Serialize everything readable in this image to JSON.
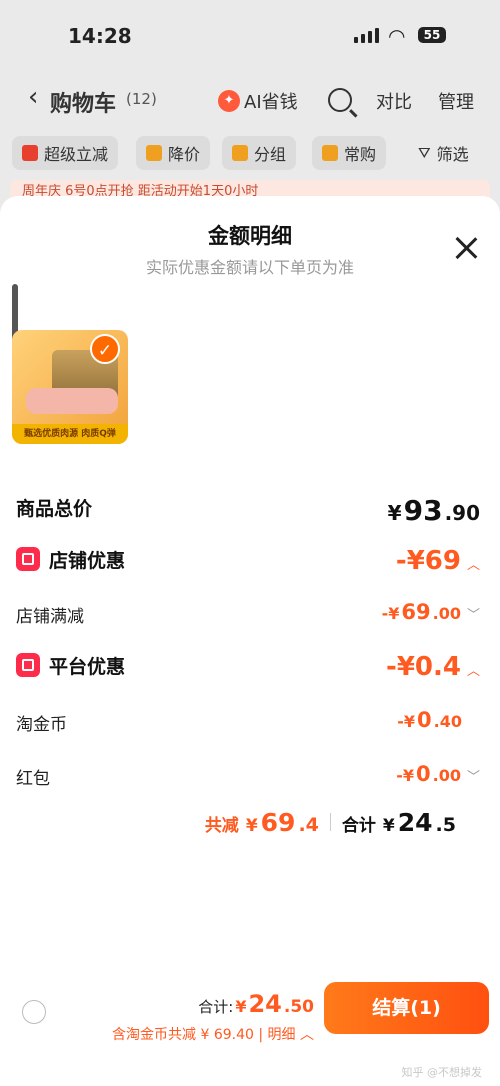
{
  "status": {
    "time": "14:28",
    "battery": "55"
  },
  "nav": {
    "title": "购物车",
    "count": "(12)",
    "ai_label": "AI省钱",
    "compare": "对比",
    "manage": "管理"
  },
  "chips": [
    "超级立减",
    "降价",
    "分组",
    "常购",
    "筛选"
  ],
  "banner": "周年庆 6号0点开抢 距活动开始1天0小时",
  "sheet": {
    "title": "金额明细",
    "subtitle": "实际优惠金额请以下单页为准",
    "product_strip": "甄选优质肉源 肉质Q弹",
    "rows": {
      "total_price": {
        "label": "商品总价",
        "currency": "¥",
        "int": "93",
        "dec": ".90"
      },
      "shop_discount": {
        "label": "店铺优惠",
        "value": "-¥69"
      },
      "shop_full_reduce": {
        "label": "店铺满减",
        "prefix": "-¥",
        "int": "69",
        "dec": ".00"
      },
      "platform_discount": {
        "label": "平台优惠",
        "value": "-¥0.4"
      },
      "taobao_coin": {
        "label": "淘金币",
        "prefix": "-¥",
        "int": "0",
        "dec": ".40"
      },
      "red_packet": {
        "label": "红包",
        "prefix": "-¥",
        "int": "0",
        "dec": ".00"
      }
    },
    "summary": {
      "saved_label": "共减",
      "saved_currency": "¥",
      "saved_int": "69",
      "saved_dec": ".4",
      "total_label": "合计",
      "total_currency": "¥",
      "total_int": "24",
      "total_dec": ".5"
    }
  },
  "footer": {
    "sum_label": "合计:",
    "sum_currency": "¥",
    "sum_int": "24",
    "sum_dec": ".50",
    "sub_text": "含淘金币共减 ¥ 69.40 | 明细",
    "checkout_label": "结算(1)"
  },
  "watermark": "知乎 @不想掉发",
  "colors": {
    "accent": "#ff5a1f",
    "badge": "#ff2b4a",
    "button": "#ff6a00"
  }
}
